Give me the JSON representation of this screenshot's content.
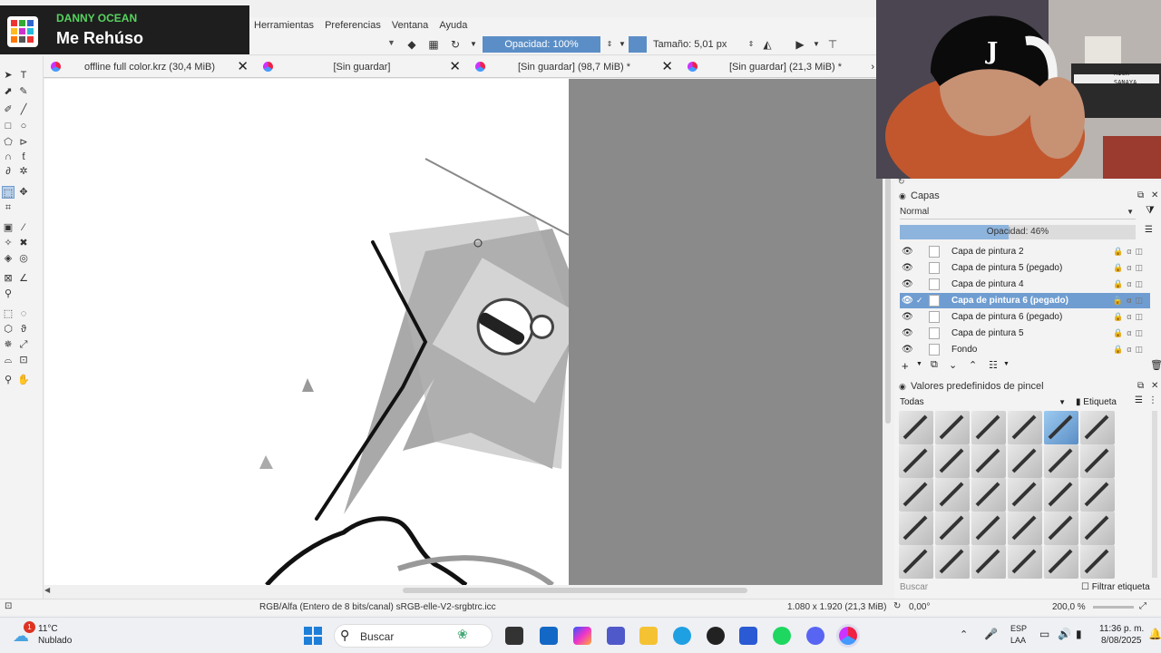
{
  "now_playing": {
    "artist": "DANNY OCEAN",
    "song": "Me Rehúso"
  },
  "menu": [
    "Herramientas",
    "Preferencias",
    "Ventana",
    "Ayuda"
  ],
  "toolbar": {
    "opacity": "Opacidad: 100%",
    "size": "Tamaño: 5,01 px"
  },
  "tabs": [
    {
      "label": "offline full color.krz (30,4 MiB)"
    },
    {
      "label": "[Sin guardar]"
    },
    {
      "label": "[Sin guardar]  (98,7 MiB) *"
    },
    {
      "label": "[Sin guardar]  (21,3 MiB) *"
    }
  ],
  "layers_panel": {
    "title": "Capas",
    "blend_mode": "Normal",
    "opacity_label": "Opacidad:  46%",
    "opacity_value": 46,
    "layers": [
      {
        "name": "Capa de pintura 2",
        "selected": false
      },
      {
        "name": "Capa de pintura 5 (pegado)",
        "selected": false
      },
      {
        "name": "Capa de pintura 4",
        "selected": false
      },
      {
        "name": "Capa de pintura 6 (pegado)",
        "selected": true
      },
      {
        "name": "Capa de pintura 6 (pegado)",
        "selected": false
      },
      {
        "name": "Capa de pintura 5",
        "selected": false
      },
      {
        "name": "Fondo",
        "selected": false
      }
    ]
  },
  "brush_panel": {
    "title": "Valores predefinidos de pincel",
    "filter": "Todas",
    "tag": "Etiqueta",
    "search_placeholder": "Buscar",
    "filter_tag_label": "Filtrar etiqueta"
  },
  "statusbar": {
    "color_info": "RGB/Alfa (Entero de 8 bits/canal)  sRGB-elle-V2-srgbtrc.icc",
    "dimensions": "1.080 x 1.920 (21,3 MiB)",
    "rotation": "0,00°",
    "zoom": "200,0 %"
  },
  "taskbar": {
    "weather_temp": "11°C",
    "weather_desc": "Nublado",
    "weather_badge": "1",
    "search_label": "Buscar",
    "lang_top": "ESP",
    "lang_bottom": "LAA",
    "time": "11:36 p. m.",
    "date": "8/08/2025"
  },
  "webcam": {
    "cap_letter": "J",
    "sign_text": "RICK SANAYA"
  },
  "colors": {
    "accent": "#5b8ec6",
    "selected_layer": "#6f9dd1",
    "artist_green": "#57d35f"
  }
}
